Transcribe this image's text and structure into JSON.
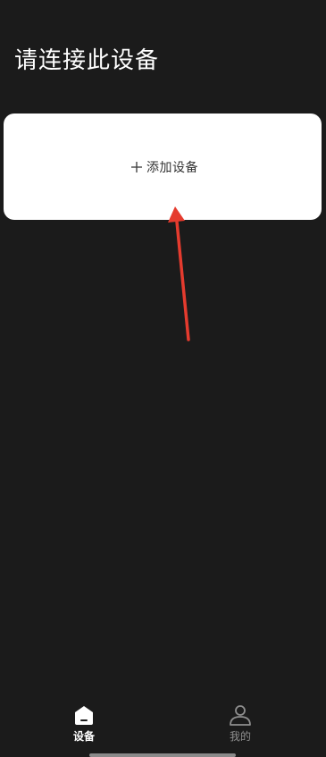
{
  "header": {
    "title": "请连接此设备"
  },
  "add_device": {
    "label": "添加设备",
    "icon": "plus-icon"
  },
  "annotation": {
    "arrow_color": "#e53b2e",
    "icon": "red-arrow"
  },
  "tab_bar": {
    "tabs": [
      {
        "label": "设备",
        "icon": "home-icon",
        "active": true
      },
      {
        "label": "我的",
        "icon": "person-icon",
        "active": false
      }
    ]
  },
  "colors": {
    "background": "#1b1b1b",
    "card": "#ffffff",
    "active_tab": "#ffffff",
    "inactive_tab": "#8e8e8e"
  }
}
